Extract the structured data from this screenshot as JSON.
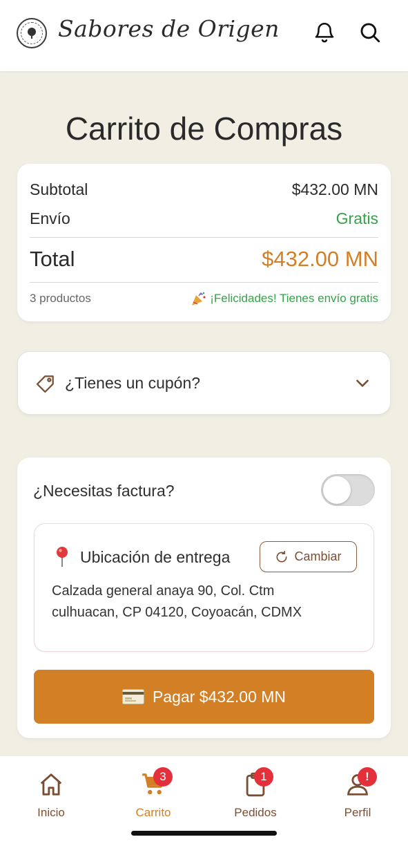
{
  "header": {
    "brand": "Sabores de Origen",
    "icons": [
      "bell-icon",
      "search-icon"
    ]
  },
  "page_title": "Carrito de Compras",
  "summary": {
    "subtotal_label": "Subtotal",
    "subtotal_value": "$432.00 MN",
    "shipping_label": "Envío",
    "shipping_value": "Gratis",
    "total_label": "Total",
    "total_value": "$432.00 MN",
    "products_count": "3 productos",
    "free_shipping_message": "¡Felicidades! Tienes envío gratis"
  },
  "coupon": {
    "label": "¿Tienes un cupón?"
  },
  "checkout": {
    "invoice_label": "¿Necesitas factura?",
    "invoice_toggle_on": false,
    "location_title": "Ubicación de entrega",
    "change_button": "Cambiar",
    "address": "Calzada general anaya 90, Col. Ctm culhuacan, CP 04120, Coyoacán, CDMX",
    "pay_button": "Pagar $432.00 MN"
  },
  "tabbar": {
    "items": [
      {
        "label": "Inicio",
        "icon": "home-icon",
        "active": false,
        "badge": ""
      },
      {
        "label": "Carrito",
        "icon": "cart-icon",
        "active": true,
        "badge": "3"
      },
      {
        "label": "Pedidos",
        "icon": "clipboard-icon",
        "active": false,
        "badge": "1"
      },
      {
        "label": "Perfil",
        "icon": "user-icon",
        "active": false,
        "badge": "!"
      }
    ]
  },
  "colors": {
    "accent": "#d37f26",
    "brown": "#7a4e33",
    "success": "#35a24a",
    "badge": "#e3303a",
    "background": "#f1efe4"
  }
}
